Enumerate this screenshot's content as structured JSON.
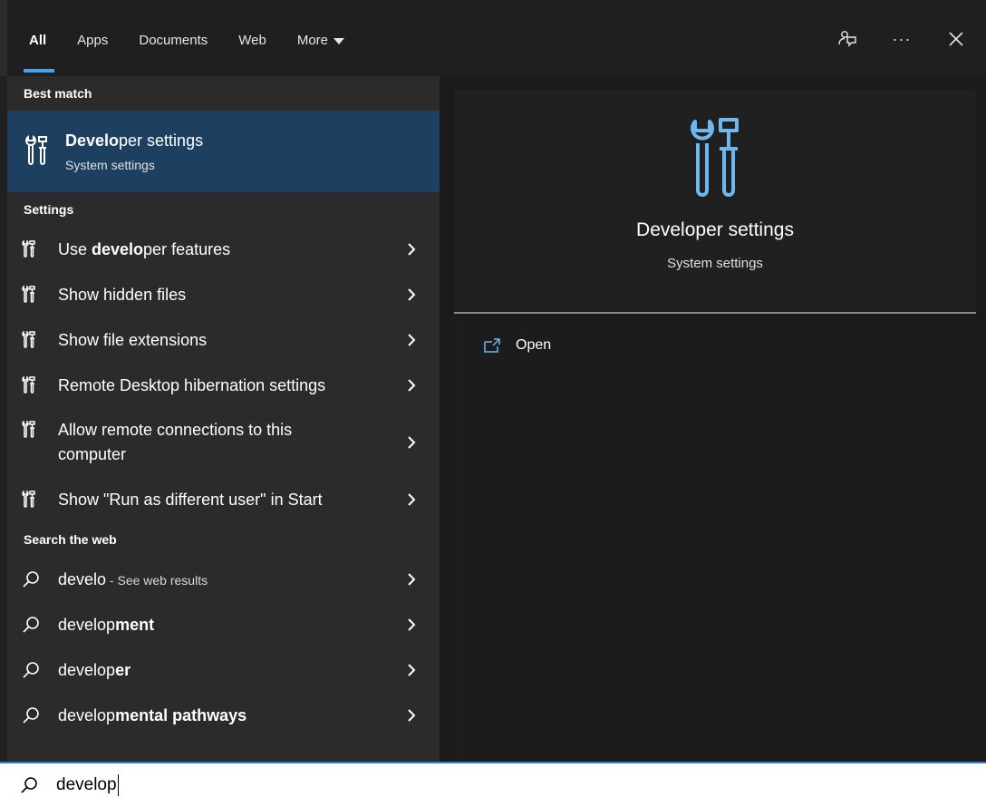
{
  "tabs": [
    {
      "label": "All",
      "active": true
    },
    {
      "label": "Apps"
    },
    {
      "label": "Documents"
    },
    {
      "label": "Web"
    },
    {
      "label": "More"
    }
  ],
  "top_icons": [
    "feedback-icon",
    "more-icon",
    "close-icon"
  ],
  "top_more_glyph": "···",
  "best_match": {
    "heading": "Best match",
    "title_bold": "Develo",
    "title_rest": "per settings",
    "subtitle": "System settings"
  },
  "settings": {
    "heading": "Settings",
    "items": [
      {
        "pre": "Use ",
        "bold": "develo",
        "post": "per features"
      },
      {
        "pre": "Show hidden files",
        "bold": "",
        "post": ""
      },
      {
        "pre": "Show file extensions",
        "bold": "",
        "post": ""
      },
      {
        "pre": "Remote Desktop hibernation settings",
        "bold": "",
        "post": ""
      },
      {
        "pre": "Allow remote connections to this computer",
        "bold": "",
        "post": ""
      },
      {
        "pre": "Show \"Run as different user\" in Start",
        "bold": "",
        "post": ""
      }
    ]
  },
  "web": {
    "heading": "Search the web",
    "items": [
      {
        "pre": "develo",
        "bold": "",
        "suffix": " - See web results"
      },
      {
        "pre": "develop",
        "bold": "ment",
        "suffix": ""
      },
      {
        "pre": "develop",
        "bold": "er",
        "suffix": ""
      },
      {
        "pre": "develop",
        "bold": "mental pathways",
        "suffix": ""
      }
    ]
  },
  "preview": {
    "title": "Developer settings",
    "subtitle": "System settings",
    "action": "Open"
  },
  "search": {
    "value": "develop"
  },
  "colors": {
    "accent": "#4aa3e8",
    "selected": "#1e4060",
    "pane_left": "#2b2b2b",
    "pane_right": "#1c1c1c"
  }
}
